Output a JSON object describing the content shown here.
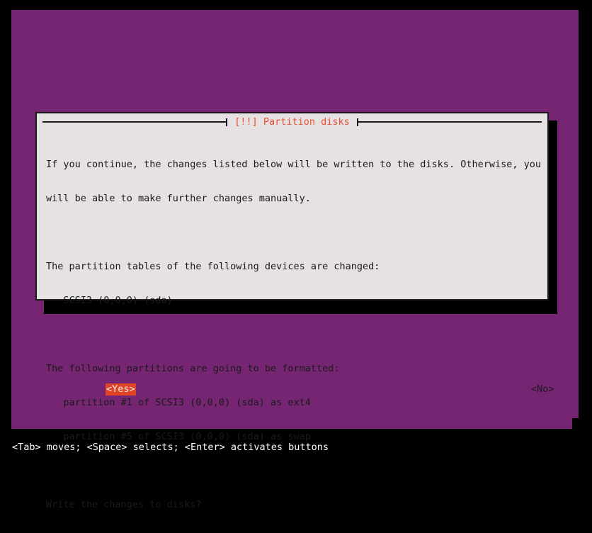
{
  "screen": {
    "background_color": "#000000",
    "backdrop_color": "#762572"
  },
  "dialog": {
    "title": "[!!] Partition disks",
    "title_color": "#e84f30",
    "background_color": "#e6e2e4",
    "border_color": "#1a1a1a",
    "body_lines": [
      "If you continue, the changes listed below will be written to the disks. Otherwise, you",
      "will be able to make further changes manually.",
      "",
      "The partition tables of the following devices are changed:",
      "   SCSI3 (0,0,0) (sda)",
      "",
      "The following partitions are going to be formatted:",
      "   partition #1 of SCSI3 (0,0,0) (sda) as ext4",
      "   partition #5 of SCSI3 (0,0,0) (sda) as swap",
      "",
      "Write the changes to disks?"
    ],
    "prompt": "Write the changes to disks?",
    "devices_changed": [
      "SCSI3 (0,0,0) (sda)"
    ],
    "partitions_formatted": [
      "partition #1 of SCSI3 (0,0,0) (sda) as ext4",
      "partition #5 of SCSI3 (0,0,0) (sda) as swap"
    ],
    "buttons": {
      "yes": {
        "label": "<Yes>",
        "selected": true,
        "highlight_color": "#e04326",
        "text_color": "#efe8e6"
      },
      "no": {
        "label": "<No>",
        "selected": false,
        "text_color": "#1a1a1a"
      }
    }
  },
  "statusbar": {
    "text": "<Tab> moves; <Space> selects; <Enter> activates buttons",
    "text_color": "#ffffff",
    "background_color": "#762572"
  }
}
